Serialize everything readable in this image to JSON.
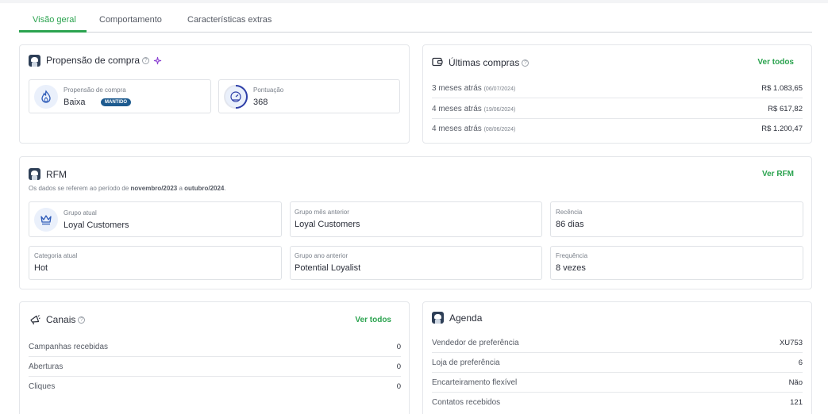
{
  "tabs": [
    {
      "label": "Visão geral",
      "active": true
    },
    {
      "label": "Comportamento",
      "active": false
    },
    {
      "label": "Características extras",
      "active": false
    }
  ],
  "propensao": {
    "title": "Propensão de compra",
    "help": "?",
    "purchase": {
      "label": "Propensão de compra",
      "value": "Baixa",
      "badge": "MANTIDO"
    },
    "score": {
      "label": "Pontuação",
      "value": "368"
    }
  },
  "ultimas": {
    "title": "Últimas compras",
    "help": "?",
    "link": "Ver todos",
    "rows": [
      {
        "label": "3 meses atrás",
        "date": "(06/07/2024)",
        "value": "R$ 1.083,65"
      },
      {
        "label": "4 meses atrás",
        "date": "(19/06/2024)",
        "value": "R$ 617,82"
      },
      {
        "label": "4 meses atrás",
        "date": "(08/06/2024)",
        "value": "R$ 1.200,47"
      }
    ]
  },
  "rfm": {
    "title": "RFM",
    "link": "Ver RFM",
    "subtitle": {
      "pre": "Os dados se referem ao período de ",
      "from": "novembro/2023",
      "mid": " a ",
      "to": "outubro/2024",
      "post": "."
    },
    "boxes": {
      "grupo_atual": {
        "label": "Grupo atual",
        "value": "Loyal Customers"
      },
      "grupo_mes": {
        "label": "Grupo mês anterior",
        "value": "Loyal Customers"
      },
      "recencia": {
        "label": "Recência",
        "value": "86 dias"
      },
      "categoria": {
        "label": "Categoria atual",
        "value": "Hot"
      },
      "grupo_ano": {
        "label": "Grupo ano anterior",
        "value": "Potential Loyalist"
      },
      "frequencia": {
        "label": "Frequência",
        "value": "8 vezes"
      }
    }
  },
  "canais": {
    "title": "Canais",
    "help": "?",
    "link": "Ver todos",
    "rows": [
      {
        "label": "Campanhas recebidas",
        "value": "0"
      },
      {
        "label": "Aberturas",
        "value": "0"
      },
      {
        "label": "Cliques",
        "value": "0"
      }
    ]
  },
  "agenda": {
    "title": "Agenda",
    "rows": [
      {
        "label": "Vendedor de preferência",
        "value": "XU753"
      },
      {
        "label": "Loja de preferência",
        "value": "6"
      },
      {
        "label": "Encarteiramento flexível",
        "value": "Não"
      },
      {
        "label": "Contatos recebidos",
        "value": "121"
      }
    ]
  },
  "colors": {
    "accent": "#2ba34f",
    "badge": "#1e5b8f",
    "score_ring": "#2e3fa8",
    "icon_bg": "#eaf0fb"
  }
}
